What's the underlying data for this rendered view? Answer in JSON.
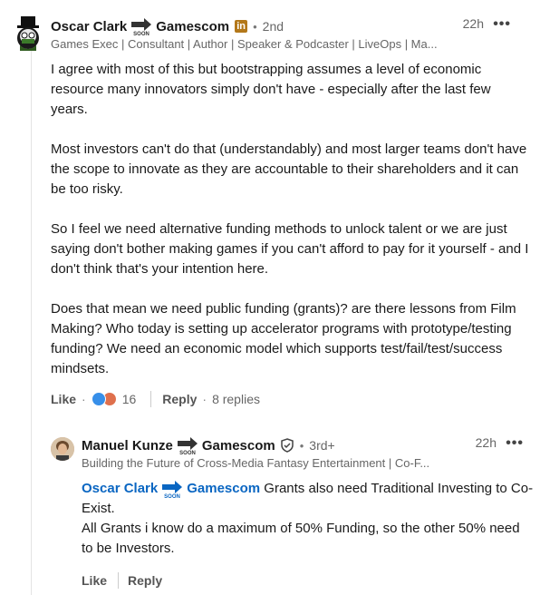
{
  "comment": {
    "author": {
      "first": "Oscar Clark",
      "second": "Gamescom",
      "badge": "in",
      "degree": "2nd",
      "headline": "Games Exec | Consultant | Author | Speaker & Podcaster | LiveOps | Ma..."
    },
    "time": "22h",
    "more": "•••",
    "paragraphs": [
      "I agree with most of this but bootstrapping assumes a level of economic resource many innovators simply don't have - especially after the last few years.",
      "Most investors can't do that (understandably) and most larger teams don't have the scope to innovate as they are accountable to their shareholders and it can be too risky.",
      "So I feel we need alternative funding methods to unlock talent or we are just saying don't bother making games if you can't afford to pay for it yourself - and I don't think that's your intention here.",
      "Does that mean we need public funding (grants)? are there lessons from Film Making? Who today is setting up accelerator programs with prototype/testing funding? We need an economic model which supports test/fail/test/success mindsets."
    ],
    "actions": {
      "like": "Like",
      "reaction_count": "16",
      "reply": "Reply",
      "replies": "8 replies"
    }
  },
  "reply": {
    "author": {
      "first": "Manuel Kunze",
      "second": "Gamescom",
      "degree": "3rd+",
      "headline": "Building the Future of Cross-Media Fantasy Entertainment | Co-F..."
    },
    "time": "22h",
    "more": "•••",
    "mention_first": "Oscar Clark",
    "mention_second": "Gamescom",
    "text_after_mention": " Grants also need Traditional Investing to Co-Exist.",
    "line2": "All Grants i know do a maximum of 50% Funding, so the other 50% need to be Investors.",
    "actions": {
      "like": "Like",
      "reply": "Reply"
    }
  },
  "colors": {
    "link": "#0a66c2",
    "like_blue": "#378fe9",
    "love_red": "#df704d"
  }
}
